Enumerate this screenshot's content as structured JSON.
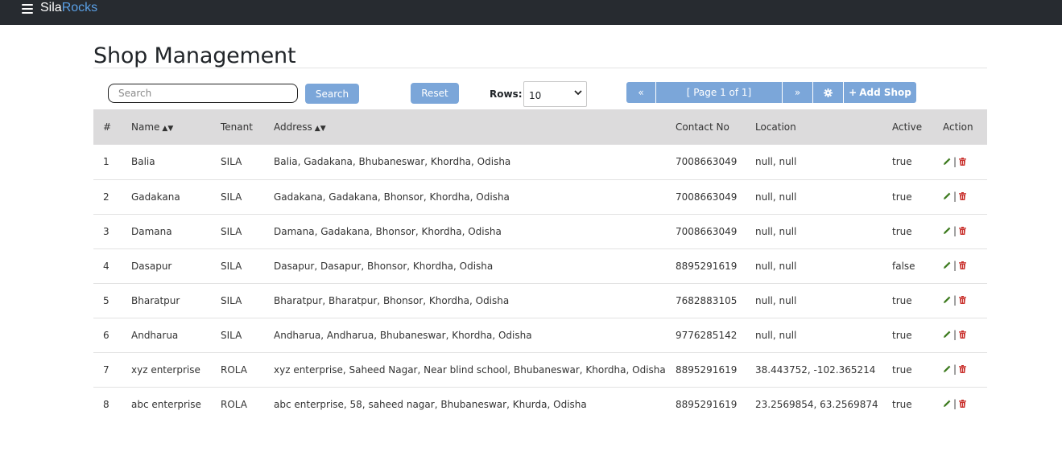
{
  "navbar": {
    "brand_part1": "Sila",
    "brand_part2": "Rocks"
  },
  "page": {
    "title": "Shop Management"
  },
  "toolbar": {
    "search_placeholder": "Search",
    "search_value": "",
    "search_button": "Search",
    "reset_button": "Reset",
    "rows_label": "Rows:",
    "rows_selected": "10",
    "pager_first": "«",
    "pager_info": "[ Page 1 of 1]",
    "pager_next": "»",
    "add_label": "Add Shop"
  },
  "table": {
    "headers": {
      "num": "#",
      "name": "Name",
      "tenant": "Tenant",
      "address": "Address",
      "contact": "Contact No",
      "location": "Location",
      "active": "Active",
      "action": "Action"
    },
    "rows": [
      {
        "num": "1",
        "name": "Balia",
        "tenant": "SILA",
        "address": "Balia, Gadakana, Bhubaneswar, Khordha, Odisha",
        "contact": "7008663049",
        "location": "null, null",
        "active": "true"
      },
      {
        "num": "2",
        "name": "Gadakana",
        "tenant": "SILA",
        "address": "Gadakana, Gadakana, Bhonsor, Khordha, Odisha",
        "contact": "7008663049",
        "location": "null, null",
        "active": "true"
      },
      {
        "num": "3",
        "name": "Damana",
        "tenant": "SILA",
        "address": "Damana, Gadakana, Bhonsor, Khordha, Odisha",
        "contact": "7008663049",
        "location": "null, null",
        "active": "true"
      },
      {
        "num": "4",
        "name": "Dasapur",
        "tenant": "SILA",
        "address": "Dasapur, Dasapur, Bhonsor, Khordha, Odisha",
        "contact": "8895291619",
        "location": "null, null",
        "active": "false"
      },
      {
        "num": "5",
        "name": "Bharatpur",
        "tenant": "SILA",
        "address": "Bharatpur, Bharatpur, Bhonsor, Khordha, Odisha",
        "contact": "7682883105",
        "location": "null, null",
        "active": "true"
      },
      {
        "num": "6",
        "name": "Andharua",
        "tenant": "SILA",
        "address": "Andharua, Andharua, Bhubaneswar, Khordha, Odisha",
        "contact": "9776285142",
        "location": "null, null",
        "active": "true"
      },
      {
        "num": "7",
        "name": "xyz enterprise",
        "tenant": "ROLA",
        "address": "xyz enterprise, Saheed Nagar, Near blind school, Bhubaneswar, Khordha, Odisha",
        "contact": "8895291619",
        "location": "38.443752, -102.365214",
        "active": "true"
      },
      {
        "num": "8",
        "name": "abc enterprise",
        "tenant": "ROLA",
        "address": "abc enterprise, 58, saheed nagar, Bhubaneswar, Khurda, Odisha",
        "contact": "8895291619",
        "location": "23.2569854, 63.2569874",
        "active": "true"
      }
    ],
    "action_separator": "|"
  },
  "icons": {
    "menu": "hamburger-icon",
    "first": "double-chevron-left-icon",
    "next": "double-chevron-right-icon",
    "settings": "gear-icon",
    "add": "plus-icon",
    "edit": "pencil-icon",
    "delete": "trash-icon",
    "sort": "sort-icon"
  },
  "colors": {
    "navbar": "#272b30",
    "brand_accent": "#5aa0e6",
    "button": "#7ba6d9",
    "header_bg": "#dcdbdc",
    "edit": "#3c7a1e",
    "delete": "#c9302c"
  }
}
